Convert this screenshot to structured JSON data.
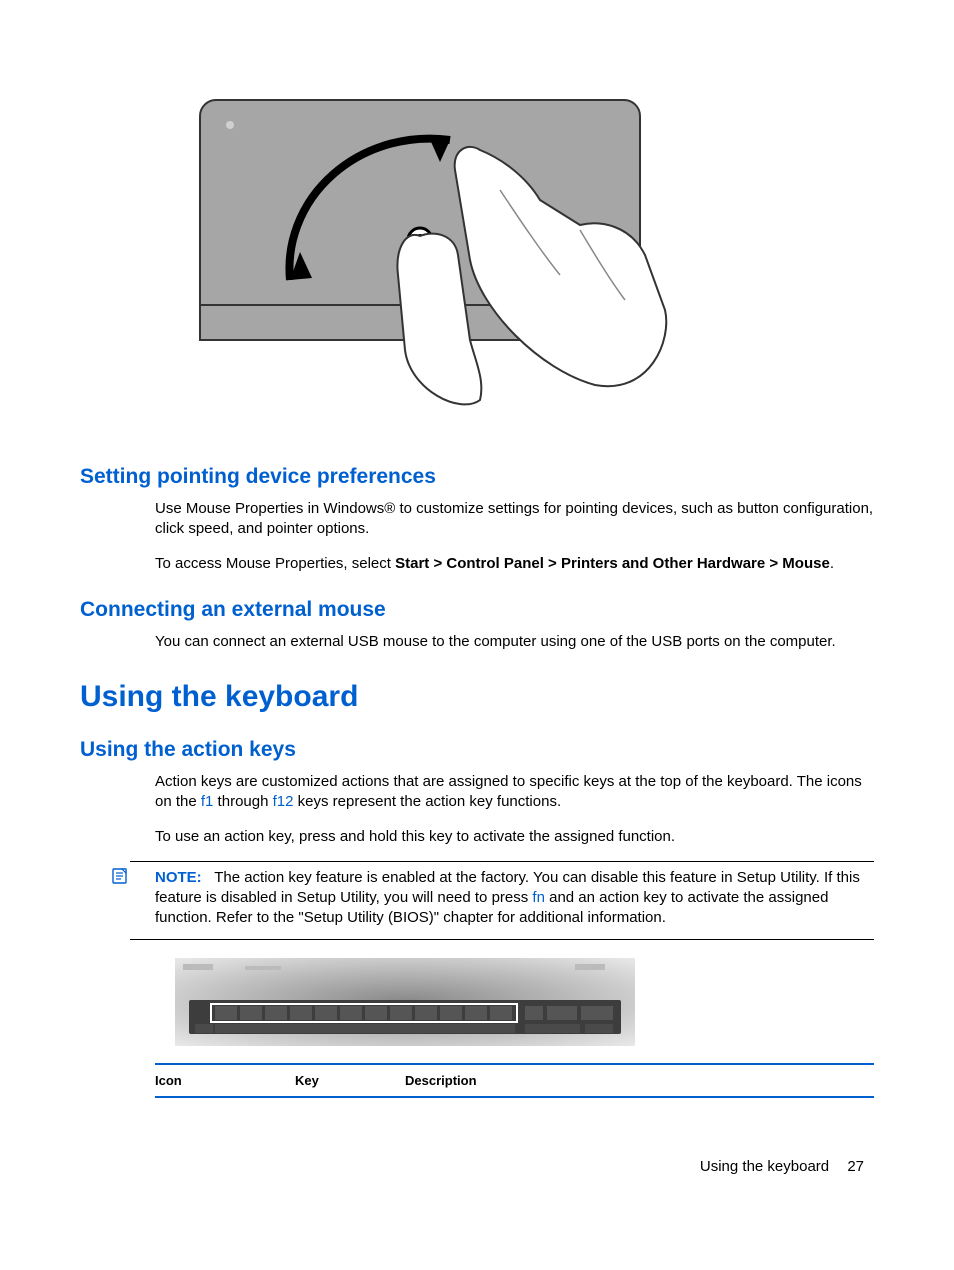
{
  "sections": {
    "setting_prefs": {
      "heading": "Setting pointing device preferences",
      "p1": "Use Mouse Properties in Windows® to customize settings for pointing devices, such as button configuration, click speed, and pointer options.",
      "p2_prefix": "To access Mouse Properties, select ",
      "p2_bold": "Start > Control Panel > Printers and Other Hardware > Mouse",
      "p2_suffix": "."
    },
    "external_mouse": {
      "heading": "Connecting an external mouse",
      "p1": "You can connect an external USB mouse to the computer using one of the USB ports on the computer."
    },
    "using_keyboard": {
      "heading": "Using the keyboard"
    },
    "action_keys": {
      "heading": "Using the action keys",
      "p1_a": "Action keys are customized actions that are assigned to specific keys at the top of the keyboard. The icons on the ",
      "p1_f1": "f1",
      "p1_b": " through ",
      "p1_f12": "f12",
      "p1_c": " keys represent the action key functions.",
      "p2": "To use an action key, press and hold this key to activate the assigned function."
    },
    "note": {
      "label": "NOTE:",
      "text_a": "The action key feature is enabled at the factory. You can disable this feature in Setup Utility. If this feature is disabled in Setup Utility, you will need to press ",
      "fn": "fn",
      "text_b": " and an action key to activate the assigned function. Refer to the \"Setup Utility (BIOS)\" chapter for additional information."
    }
  },
  "table": {
    "headers": {
      "icon": "Icon",
      "key": "Key",
      "description": "Description"
    }
  },
  "footer": {
    "label": "Using the keyboard",
    "page": "27"
  }
}
